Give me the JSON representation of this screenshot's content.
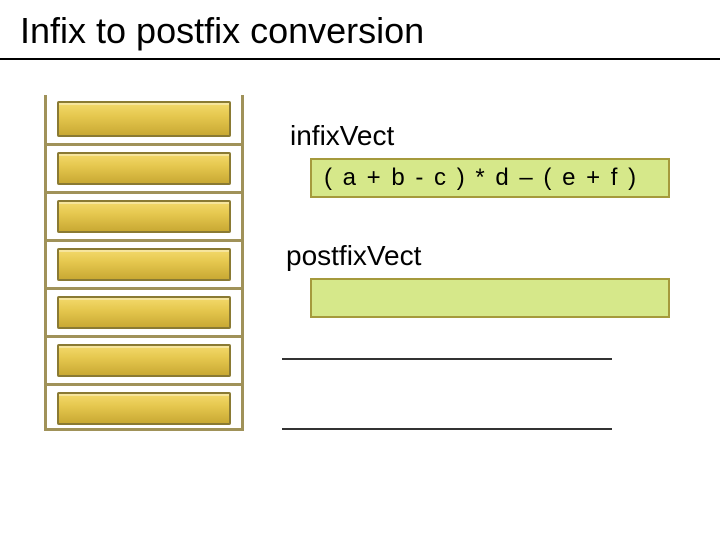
{
  "title": "Infix to postfix conversion",
  "labels": {
    "infix": "infixVect",
    "postfix": "postfixVect"
  },
  "infix_expression": "( a + b - c ) * d – ( e + f )",
  "postfix_expression": "",
  "stack": {
    "slots": 7,
    "contents": []
  },
  "chart_data": {
    "type": "table",
    "title": "Infix to postfix conversion — initial state",
    "stack_top_to_bottom": [],
    "infixVect": "( a + b - c ) * d – ( e + f )",
    "postfixVect": ""
  }
}
